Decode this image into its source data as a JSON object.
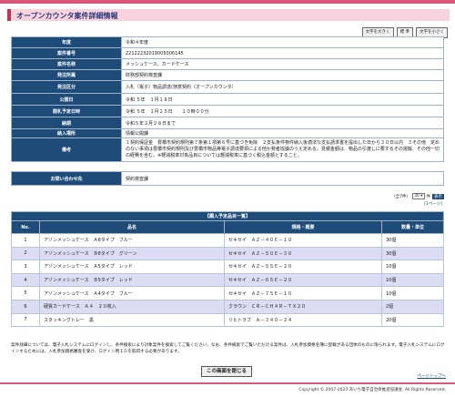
{
  "page_title": "オープンカウンタ案件詳細情報",
  "font_buttons": [
    "文字を大きく",
    "標 準",
    "文字を小さく"
  ],
  "details": [
    {
      "label": "年度",
      "value": "令和４年度"
    },
    {
      "label": "案件番号",
      "value": "22122232019005006145"
    },
    {
      "label": "案件名称",
      "value": "メッシュケース、カードケース"
    },
    {
      "label": "発注所属",
      "value": "財務部契約検査課"
    },
    {
      "label": "発注区分",
      "value": "入札（電子）物品調達(随意契約（オープンカウンタ）"
    },
    {
      "label": "公開日",
      "value": "令和 ５年　１月１８日"
    },
    {
      "label": "開札予定日時",
      "value": "令和 ５年　１月２５日　　１０時００分"
    },
    {
      "label": "納期",
      "value": "令和５年２月２８日まで"
    },
    {
      "label": "納入場所",
      "value": "情報公開課"
    },
    {
      "label": "備考",
      "value": "１契約保証金　豊橋市契約規則第７条第１項第６号に基づき免除　２支払条件物件納入後適法な支払請求書を提出した日から３０日以内　３その他　定めのない事項は豊橋市契約規則及び豊橋市物品等電子調達要領による他か発者協議のうえ定める。見積金額は、物品の引渡しに要するその運搬、その他一切の経費を含む。※軽減税率対象品目については軽減税率に基づく税込金額とすること。"
    }
  ],
  "contact": {
    "label": "お問い合わせ先",
    "value": "契約検査課"
  },
  "pager": {
    "total": "（全7件）",
    "per_page": "30",
    "unit": "件",
    "go": "表示",
    "page_link": "[1ページ]"
  },
  "items_caption": "【購入予定品目一覧】",
  "items_headers": [
    "No.",
    "品名",
    "規格・概要",
    "数量・単位"
  ],
  "items": [
    {
      "no": "1",
      "name": "アゾンメッシュケース　Ａ6タイプ　ブルー",
      "spec": "セキセイ　ＡＺ－４０Ｅ－１０",
      "qty": "30個"
    },
    {
      "no": "2",
      "name": "アゾンメッシュケース　Ｂ6タイプ　グリーン",
      "spec": "セキセイ　ＡＺ－５０Ｅ－３０",
      "qty": "30個"
    },
    {
      "no": "3",
      "name": "アゾンメッシュケース　Ａ5タイプ　レッド",
      "spec": "セキセイ　ＡＺ－５５Ｅ－２０",
      "qty": "10個"
    },
    {
      "no": "4",
      "name": "アゾンメッシュケース　Ｂ5タイプ　レッド",
      "spec": "セキセイ　ＡＺ－６５Ｅ－２０",
      "qty": "10個"
    },
    {
      "no": "5",
      "name": "アゾンメッシュケース　Ａ4タイプ　ブルー",
      "spec": "セキセイ　ＡＺ－７５Ｅ－１０",
      "qty": "10個"
    },
    {
      "no": "6",
      "name": "硬質カードケース　Ａ４　２０枚入",
      "spec": "クラウン　ＣＲ－ＣＨ４Ｒ－ＴＸ２０",
      "qty": "2個"
    },
    {
      "no": "7",
      "name": "スタッキングトレー　黒",
      "spec": "リヒトラブ　Ａ－３４０－２４",
      "qty": "20個"
    }
  ],
  "note": "案件詳細については、電子入札システムにログインし、条件検索により対象案件を検索してご覧ください。なお、条件検索でご覧いただける案件は、入札参加資格名簿に登載がある団体のものに限られます。電子入札システムにログインするためには、入札参加資格審査を受け、ログイン用ＩＤを取得する必要があります。",
  "close_button": "この画面を閉じる",
  "page_top": "ページトップへ",
  "copyright": "Copyright © 2007-2023 あいち電子自治体推進協議会. All Rights Reserved.",
  "colors": {
    "accent": "#d9577a",
    "header_bg": "#1f4b78",
    "row_alt": "#dcdcf4"
  }
}
